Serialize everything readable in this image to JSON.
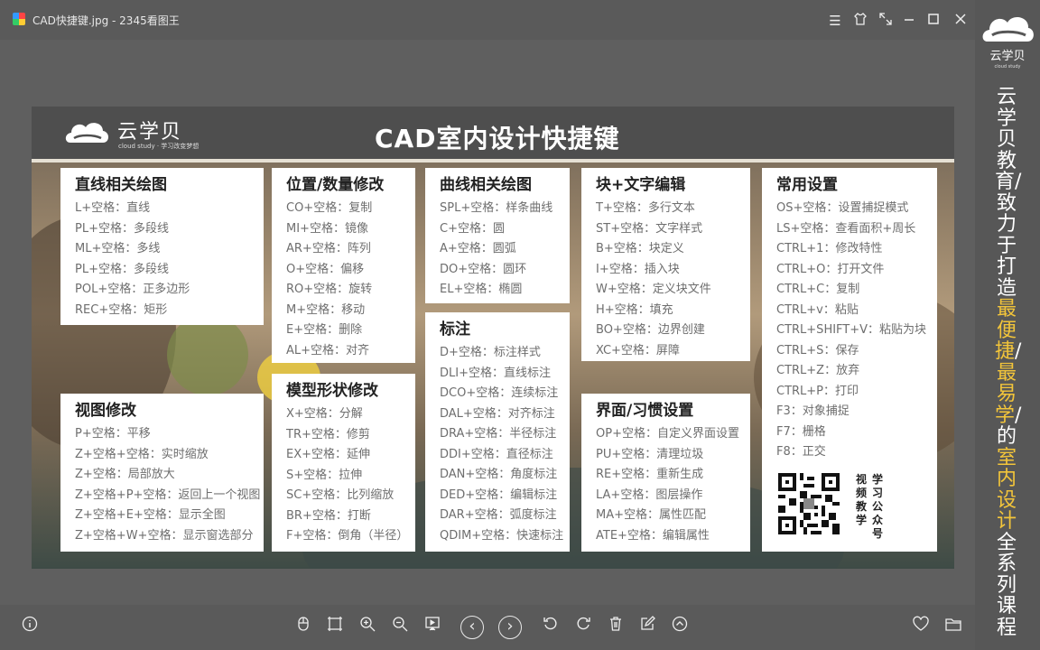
{
  "window": {
    "title": "CAD快捷键.jpg - 2345看图王",
    "controls": [
      "menu-icon",
      "skin-icon",
      "fullscreen-icon",
      "minimize-icon",
      "maximize-icon",
      "close-icon"
    ]
  },
  "poster": {
    "logo_text": "云学贝",
    "logo_sub": "cloud study  ·  学习改变梦想",
    "title": "CAD室内设计快捷键",
    "cards": [
      {
        "title": "直线相关绘图",
        "items": [
          "L+空格：直线",
          "PL+空格：多段线",
          "ML+空格：多线",
          "PL+空格：多段线",
          "POL+空格：正多边形",
          "REC+空格：矩形"
        ]
      },
      {
        "title": "视图修改",
        "items": [
          "P+空格：平移",
          "Z+空格+空格：实时缩放",
          "Z+空格：局部放大",
          "Z+空格+P+空格：返回上一个视图",
          "Z+空格+E+空格：显示全图",
          "Z+空格+W+空格：显示窗选部分"
        ]
      },
      {
        "title": "位置/数量修改",
        "items": [
          "CO+空格：复制",
          "MI+空格：镜像",
          "AR+空格：阵列",
          "O+空格：偏移",
          "RO+空格：旋转",
          "M+空格：移动",
          "E+空格：删除",
          "AL+空格：对齐"
        ]
      },
      {
        "title": "模型形状修改",
        "items": [
          "X+空格：分解",
          "TR+空格：修剪",
          "EX+空格：延伸",
          "S+空格：拉伸",
          "SC+空格：比列缩放",
          "BR+空格：打断",
          "F+空格：倒角（半径）"
        ]
      },
      {
        "title": "曲线相关绘图",
        "items": [
          "SPL+空格：样条曲线",
          "C+空格：圆",
          "A+空格：圆弧",
          "DO+空格：圆环",
          "EL+空格：椭圆"
        ]
      },
      {
        "title": "标注",
        "items": [
          "D+空格：标注样式",
          "DLI+空格：直线标注",
          "DCO+空格：连续标注",
          "DAL+空格：对齐标注",
          "DRA+空格：半径标注",
          "DDI+空格：直径标注",
          "DAN+空格：角度标注",
          "DED+空格：编辑标注",
          "DAR+空格：弧度标注",
          "QDIM+空格：快速标注"
        ]
      },
      {
        "title": "块+文字编辑",
        "items": [
          "T+空格：多行文本",
          "ST+空格：文字样式",
          "B+空格：块定义",
          "I+空格：插入块",
          "W+空格：定义块文件",
          "H+空格：填充",
          "BO+空格：边界创建",
          "XC+空格：屏障"
        ]
      },
      {
        "title": "界面/习惯设置",
        "items": [
          "OP+空格：自定义界面设置",
          "PU+空格：清理垃圾",
          "RE+空格：重新生成",
          "LA+空格：图层操作",
          "MA+空格：属性匹配",
          "ATE+空格：编辑属性"
        ]
      },
      {
        "title": "常用设置",
        "items": [
          "OS+空格：设置捕捉模式",
          "LS+空格：查看面积+周长",
          "CTRL+1：修改特性",
          "CTRL+O：打开文件",
          "CTRL+C：复制",
          "CTRL+v：粘贴",
          "CTRL+SHIFT+V：粘贴为块",
          "CTRL+S：保存",
          "CTRL+Z：放弃",
          "CTRL+P：打印",
          "F3：对象捕捉",
          "F7：栅格",
          "F8：正交"
        ]
      }
    ],
    "qr_caption_1": "视频教学",
    "qr_caption_2": "学习公众号"
  },
  "toolbar": {
    "left": "info-icon",
    "center": [
      "rotate-view-icon",
      "actual-size-icon",
      "zoom-in-icon",
      "zoom-out-icon",
      "slideshow-icon",
      "prev-icon",
      "next-icon",
      "rotate-left-icon",
      "rotate-right-icon",
      "delete-icon",
      "edit-icon",
      "more-icon"
    ],
    "right": [
      "favorite-icon",
      "folder-icon"
    ]
  },
  "sidebar": {
    "logo_text": "云学贝",
    "logo_sub": "cloud study",
    "slogan": "云学贝教育/致力于打造最便捷/最易学/的室内设计全系列课程",
    "highlight_color": "#f3c53a"
  }
}
